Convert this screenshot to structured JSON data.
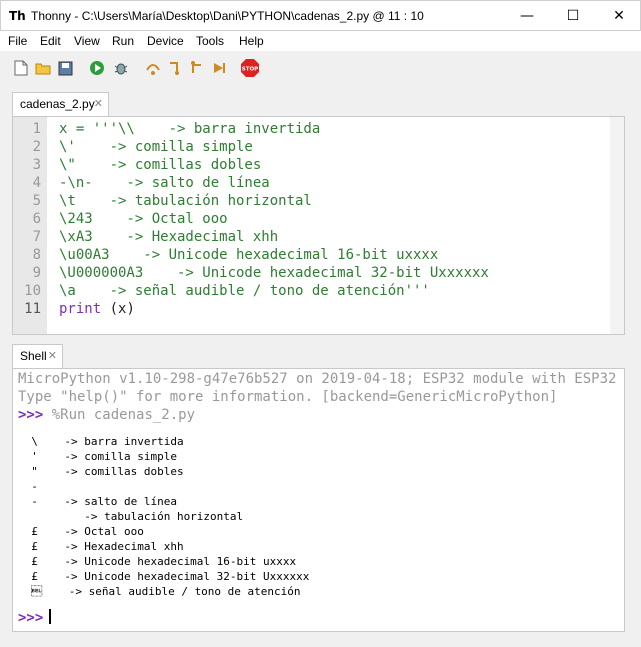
{
  "window": {
    "title": "Thonny  -  C:\\Users\\María\\Desktop\\Dani\\PYTHON\\cadenas_2.py  @  11 : 10",
    "app_icon": "Th",
    "minimize": "—",
    "maximize": "☐",
    "close": "✕"
  },
  "menu": [
    "File",
    "Edit",
    "View",
    "Run",
    "Device",
    "Tools",
    "Help"
  ],
  "toolbar": {
    "new": "new-file-icon",
    "open": "open-folder-icon",
    "save": "save-icon",
    "run": "run-icon",
    "debug": "debug-icon",
    "step_over": "step-over-icon",
    "step_into": "step-into-icon",
    "step_out": "step-out-icon",
    "resume": "resume-icon",
    "stop": "STOP"
  },
  "editor": {
    "tab_label": "cadenas_2.py",
    "lines": [
      "x = '''\\\\    -> barra invertida",
      "\\'    -> comilla simple",
      "\\\"    -> comillas dobles",
      "-\\n-    -> salto de línea",
      "\\t    -> tabulación horizontal",
      "\\243    -> Octal ooo",
      "\\xA3    -> Hexadecimal xhh",
      "\\u00A3    -> Unicode hexadecimal 16-bit uxxxx",
      "\\U000000A3    -> Unicode hexadecimal 32-bit Uxxxxxx",
      "\\a    -> señal audible / tono de atención'''"
    ],
    "line11_print": "print",
    "line11_rest": " (x)",
    "line_numbers": [
      "1",
      "2",
      "3",
      "4",
      "5",
      "6",
      "7",
      "8",
      "9",
      "10",
      "11"
    ]
  },
  "shell": {
    "tab_label": "Shell",
    "header1": "MicroPython v1.10-298-g47e76b527 on 2019-04-18; ESP32 module with ESP32",
    "header2": "Type \"help()\" for more information. [backend=GenericMicroPython]",
    "prompt": ">>>",
    "run_cmd": " %Run cadenas_2.py",
    "output": [
      "  \\    -> barra invertida",
      "  '    -> comilla simple",
      "  \"    -> comillas dobles",
      "  -",
      "  -    -> salto de línea",
      "          -> tabulación horizontal",
      "  £    -> Octal ooo",
      "  £    -> Hexadecimal xhh",
      "  £    -> Unicode hexadecimal 16-bit uxxxx",
      "  £    -> Unicode hexadecimal 32-bit Uxxxxxx",
      "  \u0007    -> señal audible / tono de atención"
    ],
    "current_prompt": ">>>"
  },
  "colors": {
    "string": "#2e7d32",
    "keyword": "#7b2fbf",
    "prompt": "#7b2fbf",
    "header": "#999999"
  }
}
